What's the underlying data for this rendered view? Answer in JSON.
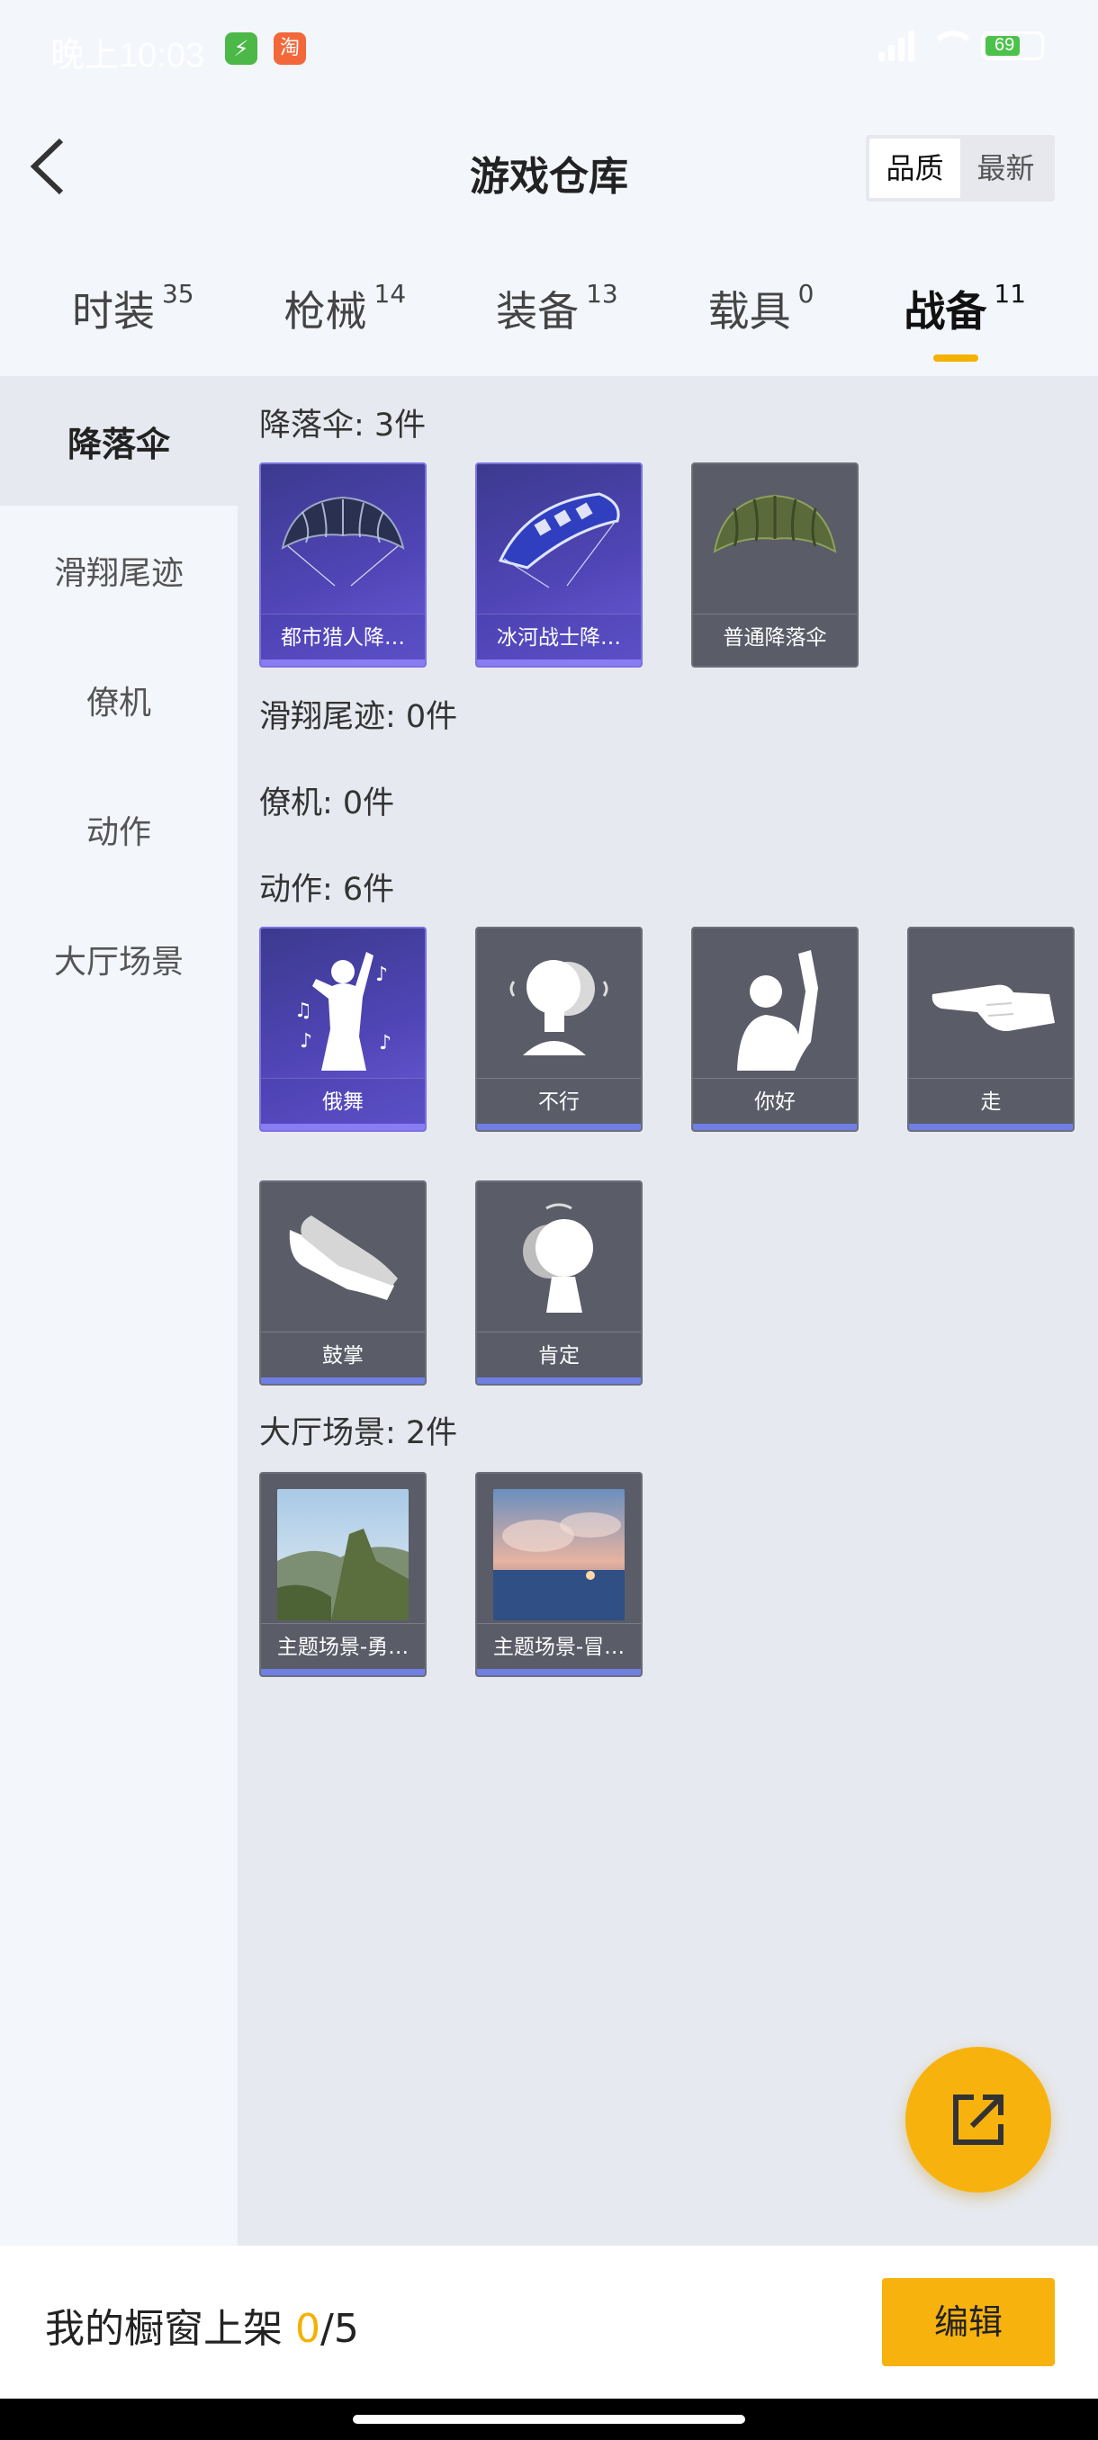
{
  "status_bar": {
    "time": "晚上10:03",
    "app1_icon": "lightning-icon",
    "app2_text": "淘",
    "battery": "69"
  },
  "header": {
    "title": "游戏仓库",
    "back_icon": "chevron-left-icon",
    "sort_options": [
      "品质",
      "最新"
    ],
    "active_sort": "品质"
  },
  "tabs": [
    {
      "label": "时装",
      "count": "35"
    },
    {
      "label": "枪械",
      "count": "14"
    },
    {
      "label": "装备",
      "count": "13"
    },
    {
      "label": "载具",
      "count": "0"
    },
    {
      "label": "战备",
      "count": "11"
    }
  ],
  "active_tab": "战备",
  "side_nav": [
    "降落伞",
    "滑翔尾迹",
    "僚机",
    "动作",
    "大厅场景"
  ],
  "active_side": "降落伞",
  "sections": {
    "parachute": {
      "title": "降落伞: 3件",
      "items": [
        "都市猎人降…",
        "冰河战士降…",
        "普通降落伞"
      ]
    },
    "glide_trail": {
      "title": "滑翔尾迹: 0件"
    },
    "wingman": {
      "title": "僚机: 0件"
    },
    "emote": {
      "title": "动作: 6件",
      "items": [
        "俄舞",
        "不行",
        "你好",
        "走",
        "鼓掌",
        "肯定"
      ]
    },
    "lobby_scene": {
      "title": "大厅场景: 2件",
      "items": [
        "主题场景-勇…",
        "主题场景-冒…"
      ]
    }
  },
  "fab_icon": "share-export-icon",
  "bottom_bar": {
    "prefix": "我的橱窗上架 ",
    "count": "0",
    "total": "/5",
    "edit_label": "编辑"
  },
  "colors": {
    "accent": "#f8b20e",
    "purple_card": "#5045b6",
    "gray_card": "#5a5c68",
    "bar_blue": "#6f7fe4"
  }
}
